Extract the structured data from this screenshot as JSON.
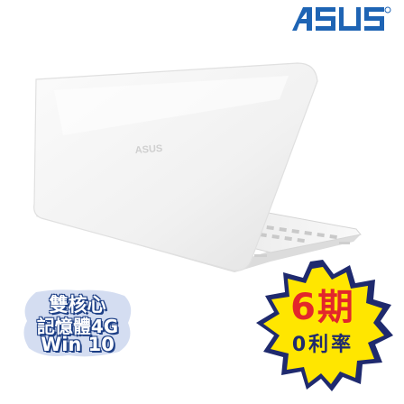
{
  "brand": {
    "logo_text": "ASUS"
  },
  "product": {
    "icon": "laptop-white",
    "lid_logo": "ASUS"
  },
  "spec_badge": {
    "line1": "雙核心",
    "line2": "記憶體4G",
    "line3": "Win 10",
    "color": "#2a55b7"
  },
  "promo_badge": {
    "headline": "6期",
    "subline": "0利率",
    "headline_color": "#e3262b",
    "fill_color": "#ffe600"
  }
}
